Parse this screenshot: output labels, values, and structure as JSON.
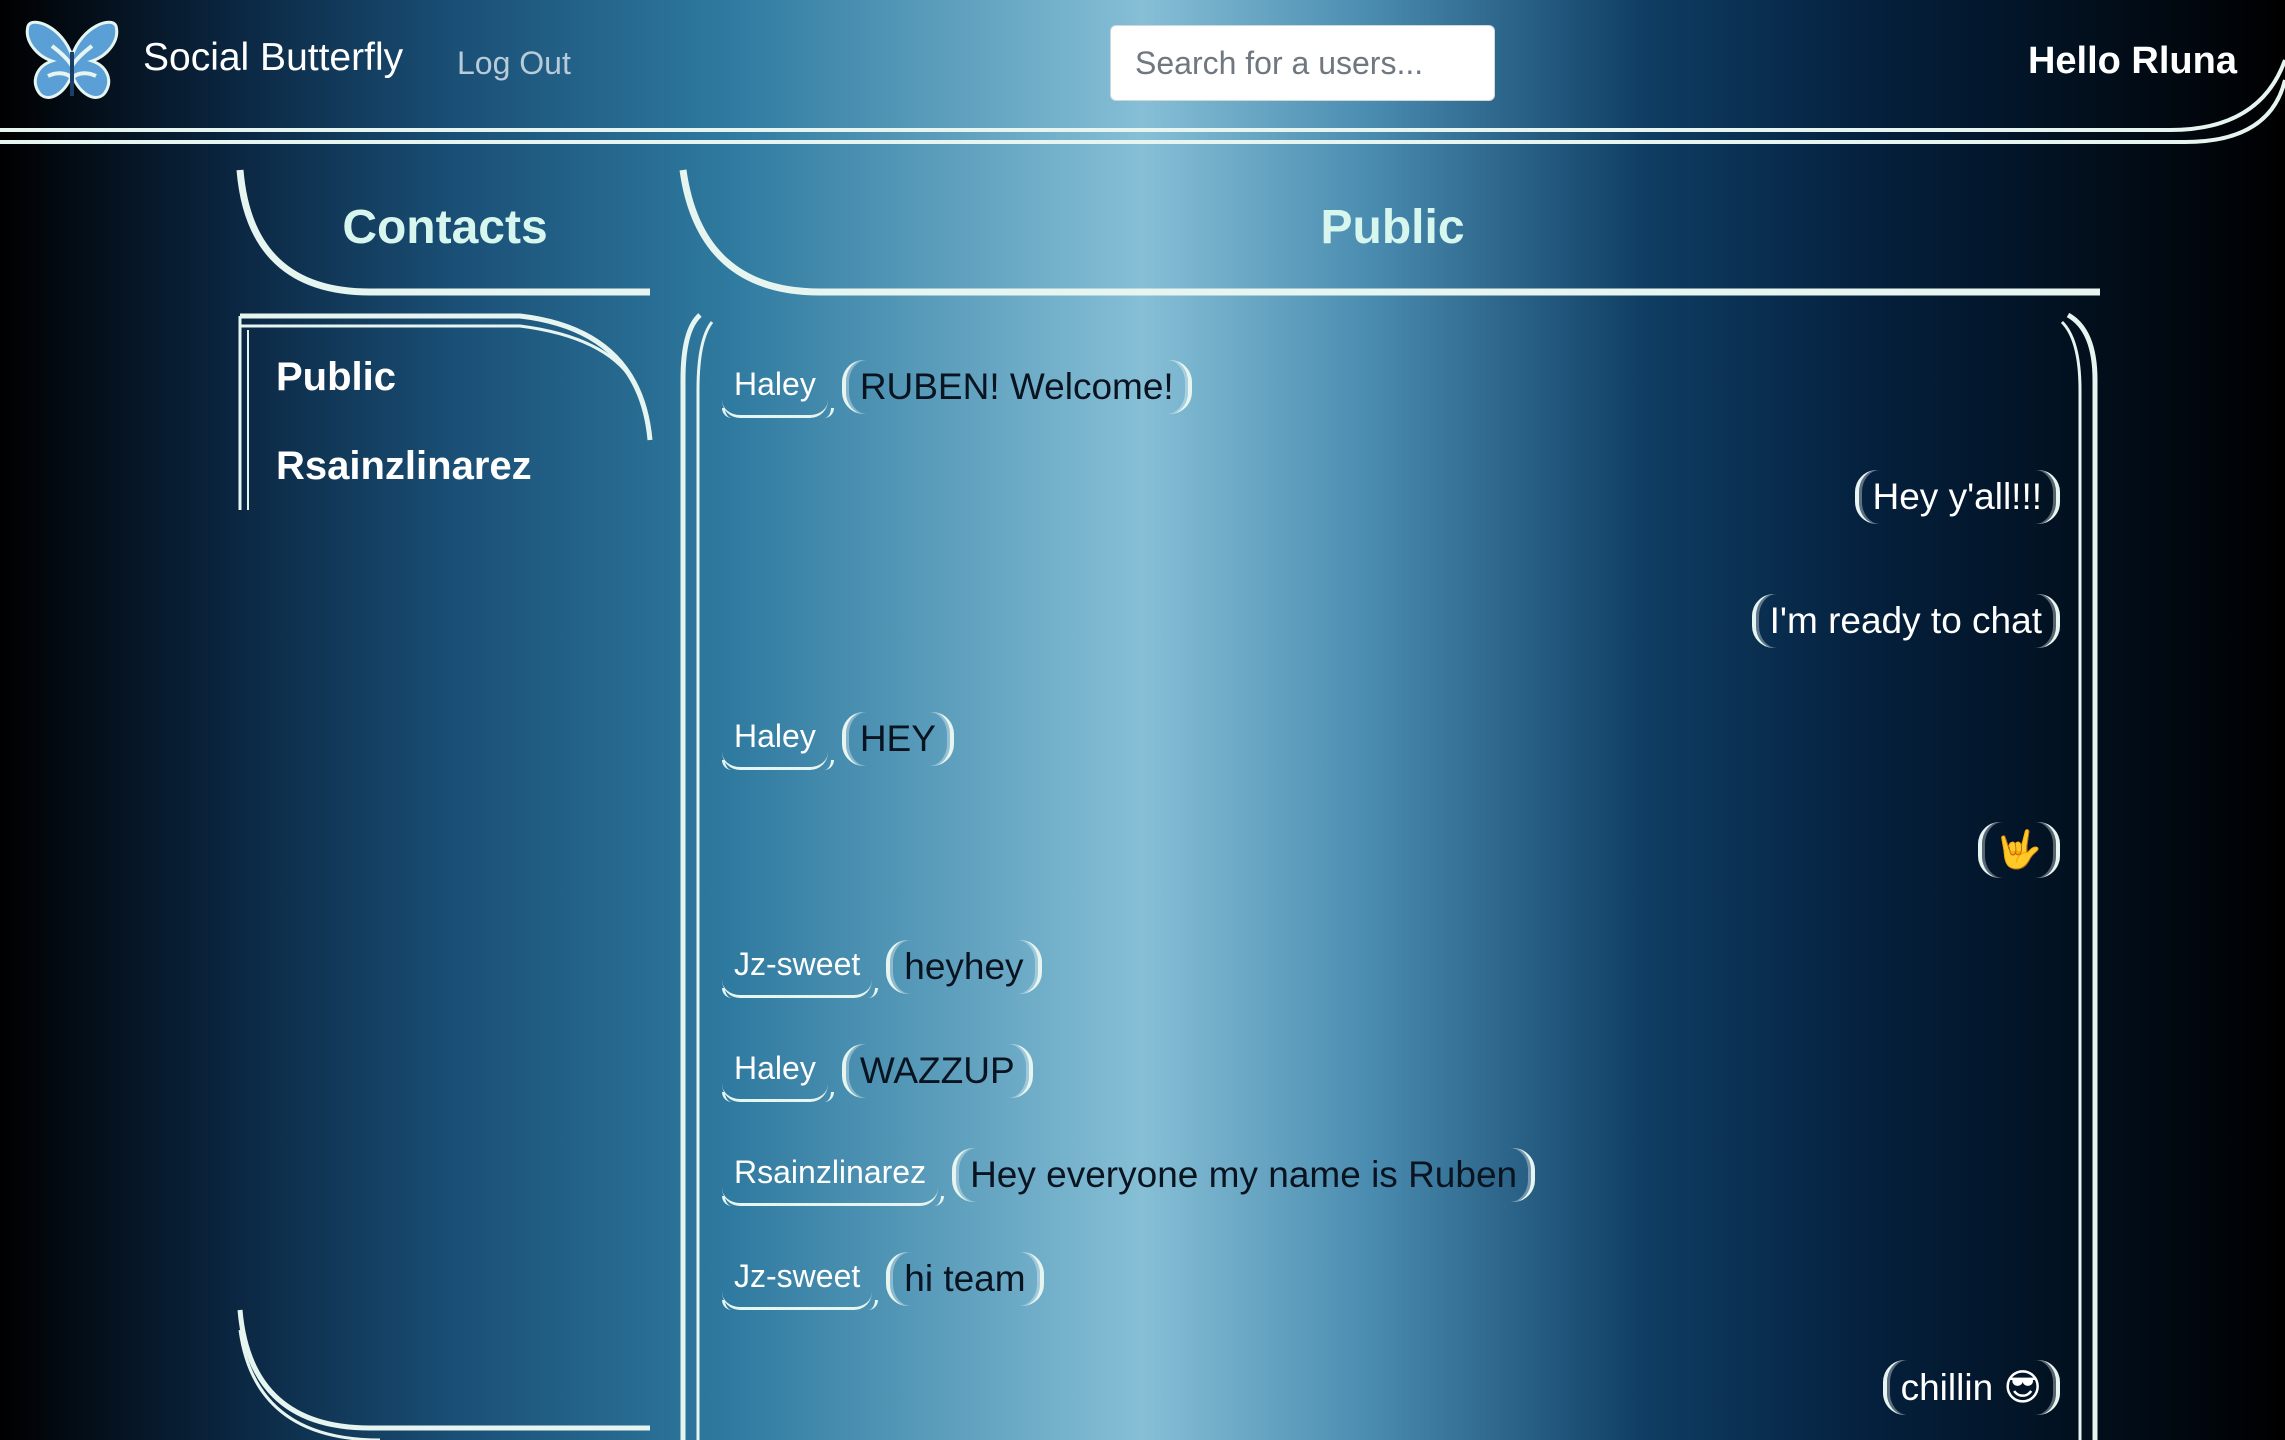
{
  "nav": {
    "brand": "Social Butterfly",
    "logout": "Log Out",
    "search_placeholder": "Search for a users...",
    "greeting": "Hello Rluna"
  },
  "contacts": {
    "title": "Contacts",
    "items": [
      "Public",
      "Rsainzlinarez"
    ]
  },
  "chat": {
    "title": "Public",
    "messages": [
      {
        "sender": "Haley",
        "text": "RUBEN! Welcome!",
        "side": "left"
      },
      {
        "sender": "",
        "text": "Hey y'all!!!",
        "side": "right"
      },
      {
        "sender": "",
        "text": "I'm ready to chat",
        "side": "right"
      },
      {
        "sender": "Haley",
        "text": "HEY",
        "side": "left"
      },
      {
        "sender": "",
        "text": "🤟",
        "side": "right",
        "icon": "love-you-gesture-emoji"
      },
      {
        "sender": "Jz-sweet",
        "text": "heyhey",
        "side": "left"
      },
      {
        "sender": "Haley",
        "text": "WAZZUP",
        "side": "left"
      },
      {
        "sender": "Rsainzlinarez",
        "text": "Hey everyone my name is Ruben",
        "side": "left"
      },
      {
        "sender": "Jz-sweet",
        "text": "hi team",
        "side": "left"
      },
      {
        "sender": "",
        "text": "chillin 😎",
        "side": "right"
      }
    ]
  },
  "colors": {
    "accent_line": "#e6f5f0",
    "heading": "#d6f6ee"
  },
  "icons": {
    "logo": "butterfly-logo-icon"
  }
}
